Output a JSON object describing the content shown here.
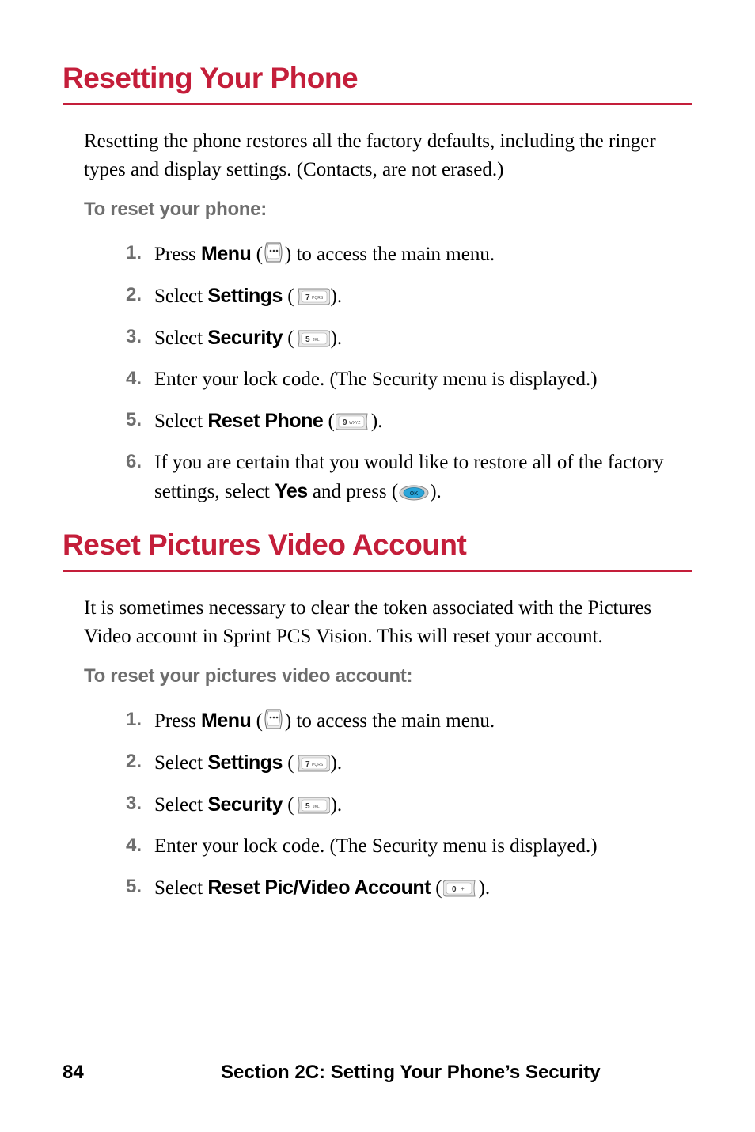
{
  "heading1": "Resetting Your Phone",
  "intro1": "Resetting the phone restores all the factory defaults, including the ringer types and display settings. (Contacts, are not erased.)",
  "subhead1": "To reset your phone:",
  "steps1": {
    "s1_pre": "Press ",
    "s1_bold": "Menu",
    "s1_post": " to access the main menu.",
    "s2_pre": "Select ",
    "s2_bold": "Settings",
    "s3_pre": "Select ",
    "s3_bold": "Security",
    "s4": "Enter your lock code. (The Security menu is displayed.)",
    "s5_pre": "Select ",
    "s5_bold": "Reset Phone",
    "s6_pre": "If you are certain that you would like to restore all of the factory settings, select ",
    "s6_bold": "Yes",
    "s6_mid": " and press"
  },
  "heading2": "Reset Pictures Video Account",
  "intro2": "It is sometimes necessary to clear the token associated with the Pictures Video account in Sprint PCS Vision. This will reset your account.",
  "subhead2": "To reset your pictures video account:",
  "steps2": {
    "s1_pre": "Press ",
    "s1_bold": "Menu",
    "s1_post": " to access the main menu.",
    "s2_pre": "Select ",
    "s2_bold": "Settings",
    "s3_pre": "Select ",
    "s3_bold": "Security",
    "s4": "Enter your lock code. (The Security menu is displayed.)",
    "s5_pre": "Select ",
    "s5_bold": "Reset Pic/Video Account"
  },
  "nums": {
    "n1": "1.",
    "n2": "2.",
    "n3": "3.",
    "n4": "4.",
    "n5": "5.",
    "n6": "6."
  },
  "key_labels": {
    "menu": "⋯",
    "settings": "7 PQRS",
    "security": "5 JKL",
    "reset_phone": "9 WXYZ",
    "ok": "OK",
    "reset_pic": "0 +"
  },
  "footer": {
    "page": "84",
    "section": "Section 2C: Setting Your Phone’s Security"
  },
  "colors": {
    "accent": "#c41e3a",
    "gray": "#6e6e6e"
  }
}
